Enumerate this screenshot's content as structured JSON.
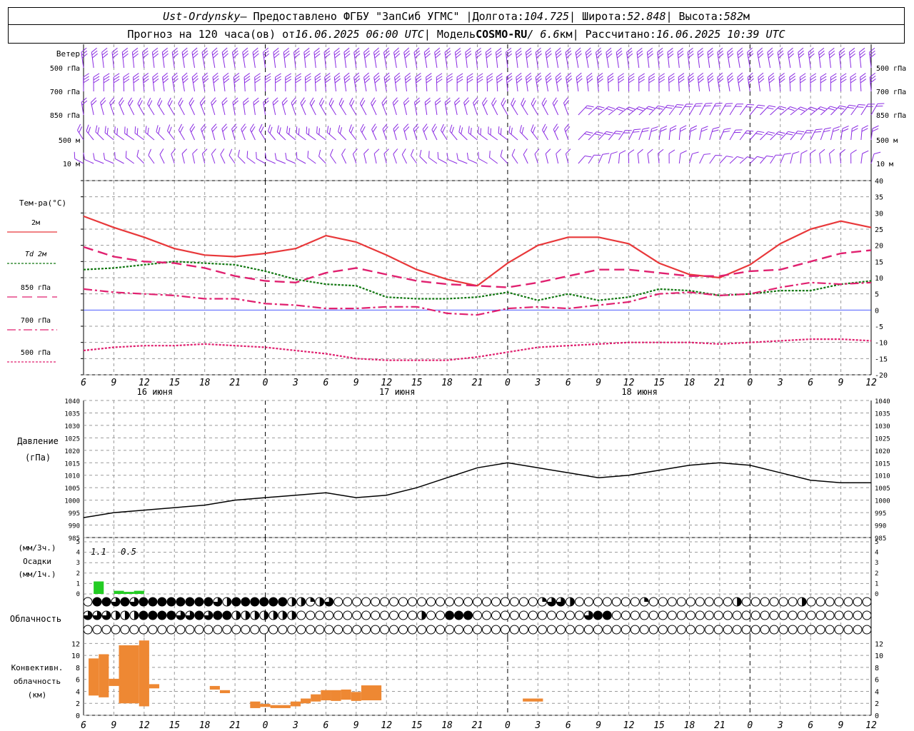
{
  "header": {
    "line1": {
      "station": "Ust-Ordynsky",
      "provider": " — Предоставлено ФГБУ \"ЗапСиб УГМС\" | ",
      "lon_label": "Долгота: ",
      "lon": "104.725",
      "lat_label": " | Широта: ",
      "lat": "52.848",
      "alt_label": " | Высота: ",
      "alt": "582",
      "alt_unit": "м"
    },
    "line2": {
      "fc_label": "Прогноз на 120 часа(ов) от ",
      "fc_time": "16.06.2025 06:00 UTC",
      "model_label": " | Модель ",
      "model": "COSMO-RU",
      "res": " / 6.6",
      "res_unit": "км",
      "calc_label": " | Рассчитано: ",
      "calc_time": "16.06.2025 10:39 UTC"
    }
  },
  "colors": {
    "t2m": "#e8383a",
    "td2m": "#117711",
    "t850": "#e0206f",
    "t700": "#e0206f",
    "t500": "#e0206f",
    "wind": "#8a2be2",
    "precip_3h": "#22cc22",
    "precip_1h": "#22cc22",
    "convective": "#ee8833",
    "zero_line": "#3344ff",
    "grid": "#999999"
  },
  "chart_data": [
    {
      "id": "wind",
      "type": "barbs",
      "title": "Ветер",
      "levels": [
        "500 гПа",
        "700 гПа",
        "850 гПа",
        "500 м",
        "10 м"
      ],
      "note": "Wind barbs at each level every hour; direction/speed not individually labeled"
    },
    {
      "id": "temperature",
      "type": "line",
      "title": "Тем-ра(°C)",
      "ylim": [
        -20,
        40
      ],
      "yticks": [
        -20,
        -15,
        -10,
        -5,
        0,
        5,
        10,
        15,
        20,
        25,
        30,
        35,
        40
      ],
      "x_hours": [
        0,
        3,
        6,
        9,
        12,
        15,
        18,
        21,
        24,
        27,
        30,
        33,
        36,
        39,
        42,
        45,
        48,
        51,
        54,
        57,
        60,
        63,
        66,
        69,
        72,
        75,
        78
      ],
      "legend": [
        "2м",
        "Td 2м",
        "850 гПа",
        "700 гПа",
        "500 гПа"
      ],
      "series": [
        {
          "name": "2м",
          "values": [
            29,
            25.5,
            22.5,
            19,
            17,
            16.5,
            17.5,
            19,
            23,
            21,
            17,
            12.5,
            9.5,
            7.5,
            14.5,
            20,
            22.5,
            22.5,
            20.5,
            14.5,
            11,
            10,
            14,
            20.5,
            25,
            27.5,
            25.5
          ]
        },
        {
          "name": "Td 2м",
          "values": [
            12.5,
            13,
            14,
            15,
            14.5,
            14,
            12,
            9.5,
            8,
            7.5,
            4,
            3.5,
            3.5,
            4,
            5.5,
            3,
            5,
            3,
            4,
            6.5,
            6,
            4.5,
            5,
            6,
            6,
            8,
            9
          ]
        },
        {
          "name": "850 гПа",
          "values": [
            19.5,
            16.5,
            15,
            14.5,
            13,
            10.5,
            9,
            8.5,
            11.5,
            13,
            11,
            9,
            8,
            7.5,
            7,
            8.5,
            10.5,
            12.5,
            12.5,
            11.5,
            10.5,
            10.5,
            12,
            12.5,
            15,
            17.5,
            18.5
          ]
        },
        {
          "name": "700 гПа",
          "values": [
            6.5,
            5.5,
            5,
            4.5,
            3.5,
            3.5,
            2,
            1.5,
            0.5,
            0.5,
            1,
            1,
            -1,
            -1.5,
            0.5,
            1,
            0.5,
            1.5,
            2.5,
            5,
            5.5,
            4.5,
            5,
            7,
            8.5,
            8,
            8.5
          ]
        },
        {
          "name": "500 гПа",
          "values": [
            -12.5,
            -11.5,
            -11,
            -11,
            -10.5,
            -11,
            -11.5,
            -12.5,
            -13.5,
            -15,
            -15.5,
            -15.5,
            -15.5,
            -14.5,
            -13,
            -11.5,
            -11,
            -10.5,
            -10,
            -10,
            -10,
            -10.5,
            -10,
            -9.5,
            -9,
            -9,
            -9.5
          ]
        }
      ]
    },
    {
      "id": "pressure",
      "type": "line",
      "title": "Давление",
      "unit": "(гПа)",
      "ylim": [
        985,
        1040
      ],
      "yticks": [
        985,
        990,
        995,
        1000,
        1005,
        1010,
        1015,
        1020,
        1025,
        1030,
        1035,
        1040
      ],
      "x_hours": [
        0,
        3,
        6,
        9,
        12,
        15,
        18,
        21,
        24,
        27,
        30,
        33,
        36,
        39,
        42,
        45,
        48,
        51,
        54,
        57,
        60,
        63,
        66,
        69,
        72,
        75,
        78
      ],
      "series": [
        {
          "name": "Давление",
          "values": [
            993,
            995,
            996,
            997,
            998,
            1000,
            1001,
            1002,
            1003,
            1001,
            1002,
            1005,
            1009,
            1013,
            1015,
            1013,
            1011,
            1009,
            1010,
            1012,
            1014,
            1015,
            1014,
            1011,
            1008,
            1007,
            1007
          ]
        }
      ]
    },
    {
      "id": "precip",
      "type": "bar",
      "title": "Осадки",
      "label_3h": "(мм/3ч.)",
      "label_1h": "(мм/1ч.)",
      "ylim": [
        0,
        5
      ],
      "yticks": [
        0,
        1,
        2,
        3,
        4,
        5
      ],
      "annotations": [
        "1.1",
        "0.5"
      ],
      "bars": [
        {
          "x_hours": [
            1,
            2
          ],
          "values": [
            1.2
          ]
        },
        {
          "x_hours": [
            3,
            4
          ],
          "values": [
            0.3
          ]
        },
        {
          "x_hours": [
            4,
            5
          ],
          "values": [
            0.2
          ]
        },
        {
          "x_hours": [
            5,
            6
          ],
          "values": [
            0.3
          ]
        }
      ]
    },
    {
      "id": "clouds",
      "type": "table",
      "title": "Облачность",
      "rows": [
        {
          "level": "upper",
          "values": [
            0,
            8,
            8,
            6,
            8,
            6,
            8,
            8,
            8,
            8,
            8,
            8,
            8,
            8,
            6,
            4,
            8,
            8,
            8,
            8,
            8,
            8,
            4,
            4,
            2,
            4,
            6,
            0,
            0,
            0,
            0,
            0,
            0,
            0,
            0,
            0,
            0,
            0,
            0,
            0,
            0,
            0,
            0,
            0,
            0,
            0,
            0,
            0,
            0,
            2,
            6,
            6,
            4,
            0,
            0,
            0,
            0,
            0,
            0,
            0,
            2,
            0,
            0,
            0,
            0,
            0,
            0,
            0,
            0,
            0,
            4,
            0,
            0,
            0,
            0,
            0,
            0,
            4,
            0,
            0,
            0,
            0,
            0,
            0,
            0
          ]
        },
        {
          "level": "middle",
          "values": [
            6,
            6,
            6,
            4,
            4,
            4,
            8,
            8,
            8,
            8,
            6,
            6,
            8,
            6,
            8,
            8,
            4,
            4,
            4,
            4,
            4,
            4,
            4,
            0,
            0,
            0,
            0,
            0,
            0,
            0,
            0,
            0,
            0,
            0,
            0,
            0,
            4,
            0,
            0,
            8,
            8,
            8,
            0,
            0,
            0,
            0,
            0,
            0,
            0,
            0,
            0,
            0,
            0,
            0,
            6,
            8,
            8,
            0,
            0,
            0,
            0,
            0,
            0,
            0,
            0,
            0,
            0,
            0,
            0,
            0,
            0,
            0,
            0,
            0,
            0,
            0,
            0,
            0,
            0,
            0,
            0,
            0,
            0,
            0,
            0
          ]
        },
        {
          "level": "lower",
          "values": [
            0,
            0,
            0,
            0,
            0,
            0,
            0,
            0,
            0,
            0,
            0,
            0,
            0,
            0,
            0,
            0,
            0,
            0,
            0,
            0,
            0,
            0,
            0,
            0,
            0,
            0,
            0,
            0,
            0,
            0,
            0,
            0,
            0,
            0,
            0,
            0,
            0,
            0,
            0,
            0,
            0,
            0,
            0,
            0,
            0,
            0,
            0,
            0,
            0,
            0,
            0,
            0,
            0,
            0,
            0,
            0,
            0,
            0,
            0,
            0,
            0,
            0,
            0,
            0,
            0,
            0,
            0,
            0,
            0,
            0,
            0,
            0,
            0,
            0,
            0,
            0,
            0,
            0,
            0,
            0,
            0,
            0,
            0,
            0,
            0
          ]
        }
      ]
    },
    {
      "id": "convective",
      "type": "bar",
      "title": "Конвективн. облачность",
      "unit": "(км)",
      "ylim": [
        0,
        13
      ],
      "yticks": [
        0,
        2,
        4,
        6,
        8,
        10,
        12
      ],
      "bars": [
        {
          "x_hours": [
            0.5,
            1.5
          ],
          "base": 3.3,
          "top": 9.5
        },
        {
          "x_hours": [
            1.5,
            2.5
          ],
          "base": 3,
          "top": 10.2
        },
        {
          "x_hours": [
            2.5,
            3.5
          ],
          "base": 4.9,
          "top": 6.1
        },
        {
          "x_hours": [
            3.5,
            5.5
          ],
          "base": 2,
          "top": 11.7
        },
        {
          "x_hours": [
            5.5,
            6.5
          ],
          "base": 1.5,
          "top": 12.5
        },
        {
          "x_hours": [
            6.5,
            7.5
          ],
          "base": 4.5,
          "top": 5.2
        },
        {
          "x_hours": [
            12.5,
            13.5
          ],
          "base": 4.3,
          "top": 4.9
        },
        {
          "x_hours": [
            13.5,
            14.5
          ],
          "base": 3.7,
          "top": 4.2
        },
        {
          "x_hours": [
            16.5,
            17.5
          ],
          "base": 1.2,
          "top": 2.3
        },
        {
          "x_hours": [
            17.5,
            18.5
          ],
          "base": 1.4,
          "top": 1.9
        },
        {
          "x_hours": [
            18.5,
            20.5
          ],
          "base": 1.2,
          "top": 1.7
        },
        {
          "x_hours": [
            20.5,
            21.5
          ],
          "base": 1.5,
          "top": 2.3
        },
        {
          "x_hours": [
            21.5,
            22.5
          ],
          "base": 2,
          "top": 2.8
        },
        {
          "x_hours": [
            22.5,
            23.5
          ],
          "base": 2.3,
          "top": 3.5
        },
        {
          "x_hours": [
            23.5,
            24.5
          ],
          "base": 2.5,
          "top": 4.2
        },
        {
          "x_hours": [
            24.5,
            25.5
          ],
          "base": 2.4,
          "top": 4.2
        },
        {
          "x_hours": [
            25.5,
            26.5
          ],
          "base": 2.6,
          "top": 4.3
        },
        {
          "x_hours": [
            26.5,
            27.5
          ],
          "base": 2.4,
          "top": 3.9
        },
        {
          "x_hours": [
            27.5,
            29.5
          ],
          "base": 2.5,
          "top": 5
        },
        {
          "x_hours": [
            43.5,
            45.5
          ],
          "base": 2.3,
          "top": 2.8
        }
      ]
    }
  ],
  "x_axis": {
    "start_hour": 6,
    "span_hours": 78,
    "tick_labels": [
      "6",
      "9",
      "12",
      "15",
      "18",
      "21",
      "0",
      "3",
      "6",
      "9",
      "12",
      "15",
      "18",
      "21",
      "0",
      "3",
      "6",
      "9",
      "12",
      "15",
      "18",
      "21",
      "0",
      "3",
      "6",
      "9",
      "12"
    ],
    "day_labels": [
      "16 июня",
      "17 июня",
      "18 июня"
    ]
  }
}
